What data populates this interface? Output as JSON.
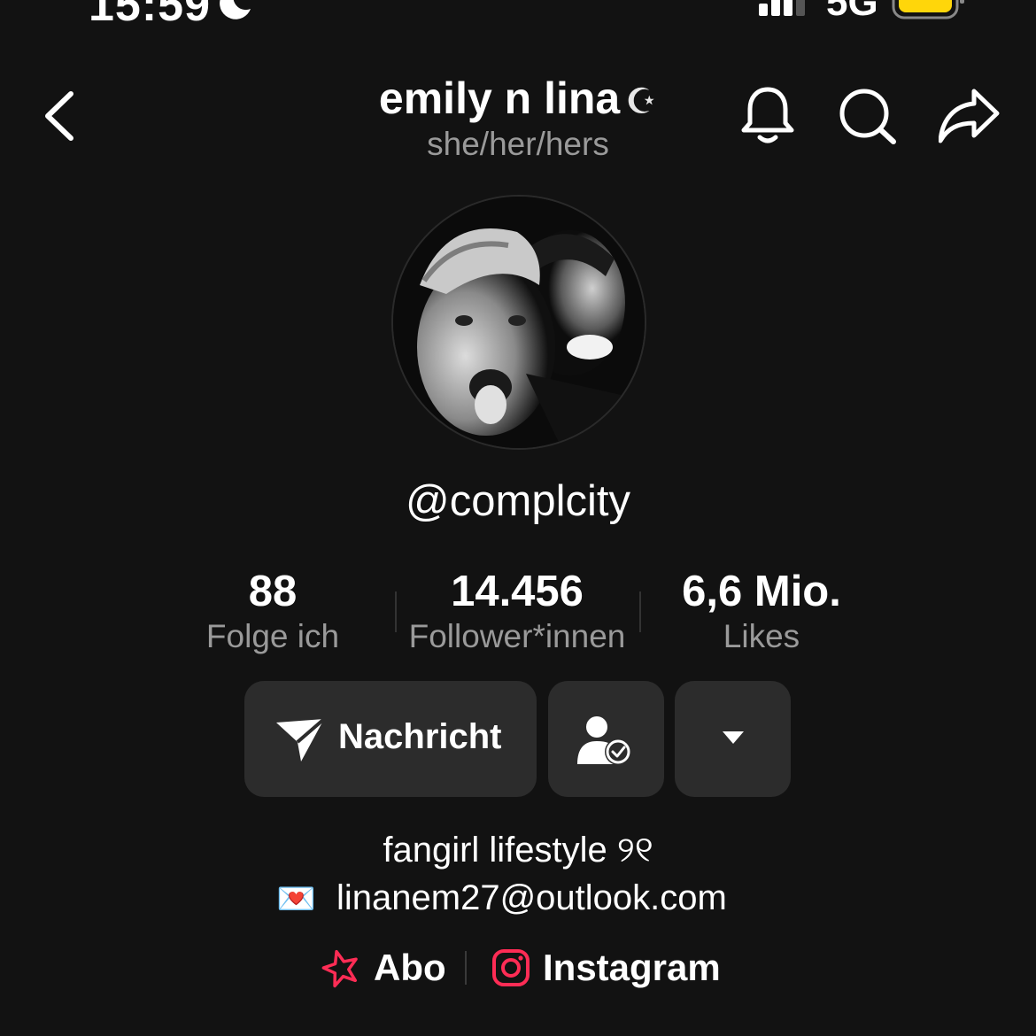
{
  "status_bar": {
    "time": "15:59",
    "network": "5G"
  },
  "header": {
    "title": "emily n lina",
    "title_glyph": "☪",
    "pronouns": "she/her/hers"
  },
  "profile": {
    "handle": "@complcity",
    "avatar_alt": "two people photo (black and white)"
  },
  "stats": [
    {
      "value": "88",
      "label": "Folge ich"
    },
    {
      "value": "14.456",
      "label": "Follower*innen"
    },
    {
      "value": "6,6 Mio.",
      "label": "Likes"
    }
  ],
  "actions": {
    "message_label": "Nachricht"
  },
  "bio": {
    "line1": "fangirl lifestyle ୨୧",
    "line2_emoji": "💌",
    "line2": "linanem27@outlook.com"
  },
  "links": {
    "abo": "Abo",
    "instagram": "Instagram"
  },
  "colors": {
    "background": "#121212",
    "button": "#2c2c2c",
    "muted_text": "#9a9a9a",
    "accent_pink": "#fe2c55",
    "battery": "#ffd60a"
  }
}
